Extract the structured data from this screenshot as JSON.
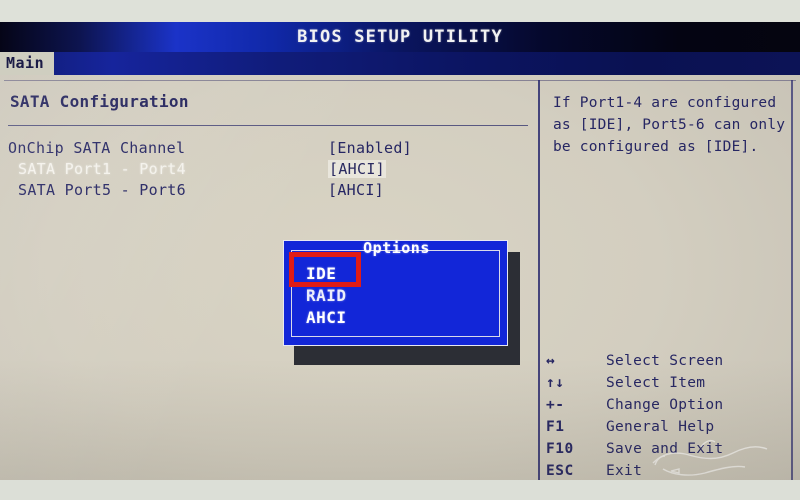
{
  "header": {
    "title": "BIOS SETUP UTILITY"
  },
  "menubar": {
    "active_tab": "Main"
  },
  "main": {
    "section_title": "SATA Configuration",
    "rows": [
      {
        "label": "OnChip SATA Channel",
        "value": "[Enabled]",
        "selected": false,
        "indent": 8
      },
      {
        "label": "SATA Port1 - Port4",
        "value": "[AHCI]",
        "selected": true,
        "indent": 18
      },
      {
        "label": "SATA Port5 - Port6",
        "value": "[AHCI]",
        "selected": false,
        "indent": 18
      }
    ]
  },
  "help": {
    "text": "If Port1-4 are configured as [IDE], Port5-6 can only be configured as [IDE]."
  },
  "navigation": {
    "keys": [
      {
        "key": "↔",
        "desc": "Select Screen",
        "icon": "left-right-arrow-icon"
      },
      {
        "key": "↑↓",
        "desc": "Select Item",
        "icon": "up-down-arrow-icon"
      },
      {
        "key": "+-",
        "desc": "Change Option",
        "icon": "plus-minus-icon"
      },
      {
        "key": "F1",
        "desc": "General Help",
        "icon": "f1-key-icon"
      },
      {
        "key": "F10",
        "desc": "Save and Exit",
        "icon": "f10-key-icon"
      },
      {
        "key": "ESC",
        "desc": "Exit",
        "icon": "esc-key-icon"
      }
    ]
  },
  "dialog": {
    "title": "Options",
    "options": [
      "IDE",
      "RAID",
      "AHCI"
    ]
  },
  "annotation": {
    "target": "IDE",
    "color": "#e01b16"
  },
  "colors": {
    "screen_background": "#d3cec0",
    "header_blue": "#1b33c8",
    "menubar_blue": "#101c6e",
    "text_blue": "#262663",
    "selected_text": "#f4f2ec",
    "dialog_blue": "#1226d8",
    "tab_background": "#cfcec0",
    "annotation_red": "#e01b16"
  }
}
